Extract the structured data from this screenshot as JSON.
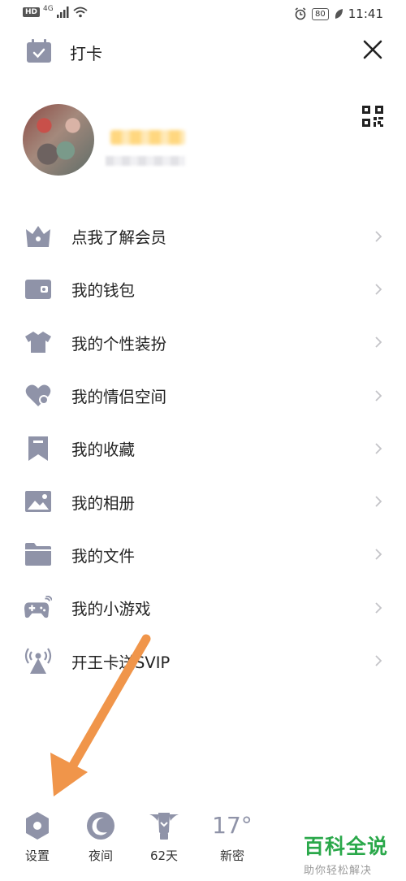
{
  "status_bar": {
    "left_badge": "HD",
    "network": "4G",
    "battery": "80",
    "time": "11:41"
  },
  "header": {
    "checkin_label": "打卡",
    "checkin_icon": "calendar-check-icon",
    "close_icon": "close-icon"
  },
  "profile": {
    "qr_icon": "qr-code-icon"
  },
  "menu": {
    "items": [
      {
        "label": "点我了解会员",
        "icon": "crown-icon"
      },
      {
        "label": "我的钱包",
        "icon": "wallet-icon"
      },
      {
        "label": "我的个性装扮",
        "icon": "shirt-icon"
      },
      {
        "label": "我的情侣空间",
        "icon": "heart-icon"
      },
      {
        "label": "我的收藏",
        "icon": "bookmark-icon"
      },
      {
        "label": "我的相册",
        "icon": "photo-icon"
      },
      {
        "label": "我的文件",
        "icon": "folder-icon"
      },
      {
        "label": "我的小游戏",
        "icon": "gamepad-icon"
      },
      {
        "label": "开王卡送SVIP",
        "icon": "antenna-icon"
      }
    ]
  },
  "bottom_bar": {
    "settings_label": "设置",
    "night_label": "夜间",
    "days_label": "62天",
    "weather_temp": "17°",
    "weather_label": "新密"
  },
  "watermark": {
    "main": "百科全说",
    "sub": "助你轻松解决"
  },
  "colors": {
    "icon": "#8f93a8",
    "arrow": "#f0954a",
    "watermark": "#2aa84a"
  }
}
